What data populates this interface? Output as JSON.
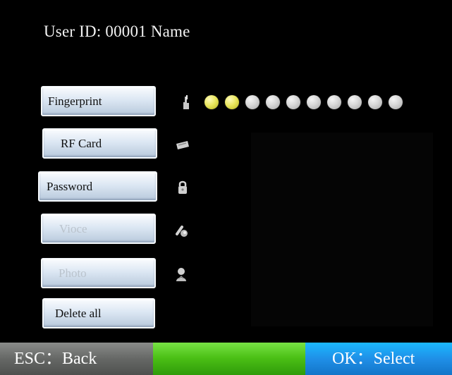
{
  "header": {
    "title": "User ID: 00001 Name"
  },
  "menu": [
    {
      "label": "Fingerprint",
      "icon": "fingerprint-icon",
      "state": "enabled"
    },
    {
      "label": "RF Card",
      "icon": "card-icon",
      "state": "enabled"
    },
    {
      "label": "Password",
      "icon": "lock-icon",
      "state": "enabled"
    },
    {
      "label": "Vioce",
      "icon": "microphone-icon",
      "state": "disabled"
    },
    {
      "label": "Photo",
      "icon": "person-icon",
      "state": "disabled"
    },
    {
      "label": "Delete all",
      "state": "enabled"
    }
  ],
  "fingerprint_progress": {
    "enrolled": 2,
    "total": 10,
    "active_color": "#e8e55b",
    "inactive_color": "#d7d7d7"
  },
  "footer": {
    "left_label": "ESC：Back",
    "right_label": "OK：Select",
    "colors": {
      "left": "#676967",
      "middle": "#4bbf15",
      "right": "#1f8ee6"
    }
  }
}
